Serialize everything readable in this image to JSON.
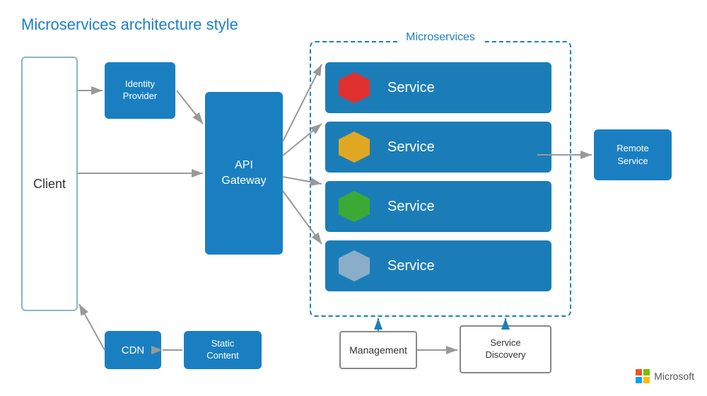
{
  "title": "Microservices architecture style",
  "microservices_section_title": "Microservices",
  "client_label": "Client",
  "identity_provider_label": "Identity\nProvider",
  "api_gateway_label": "API\nGateway",
  "services": [
    {
      "label": "Service",
      "hex_color": "red"
    },
    {
      "label": "Service",
      "hex_color": "yellow"
    },
    {
      "label": "Service",
      "hex_color": "green"
    },
    {
      "label": "Service",
      "hex_color": "bluegray"
    }
  ],
  "remote_service_label": "Remote\nService",
  "cdn_label": "CDN",
  "static_content_label": "Static\nContent",
  "management_label": "Management",
  "service_discovery_label": "Service\nDiscovery",
  "microsoft_label": "Microsoft"
}
